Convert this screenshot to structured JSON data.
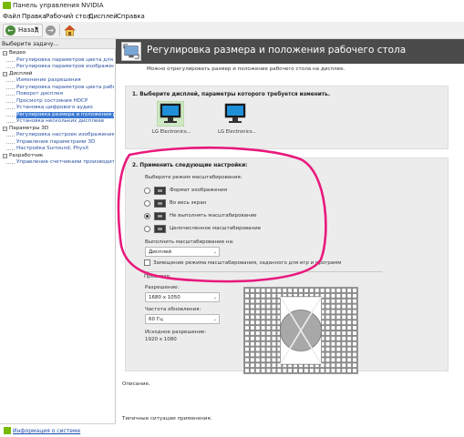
{
  "window": {
    "title": "Панель управления NVIDIA"
  },
  "menu": [
    "Файл",
    "Правка",
    "Рабочий стол",
    "Дисплей",
    "Справка"
  ],
  "toolbar": {
    "back_label": "Назад"
  },
  "left": {
    "header": "Выберите задачу...",
    "tree": [
      {
        "text": "Видео",
        "cat": true
      },
      {
        "text": "Регулировка параметров цвета для видео",
        "cat": false
      },
      {
        "text": "Регулировка параметров изображения для видео",
        "cat": false
      },
      {
        "text": "Дисплей",
        "cat": true
      },
      {
        "text": "Изменение разрешения",
        "cat": false
      },
      {
        "text": "Регулировка параметров цвета рабочего стола",
        "cat": false
      },
      {
        "text": "Поворот дисплея",
        "cat": false
      },
      {
        "text": "Просмотр состояния HDCP",
        "cat": false
      },
      {
        "text": "Установка цифрового аудио",
        "cat": false
      },
      {
        "text": "Регулировка размера и положения рабочего стола",
        "cat": false,
        "selected": true
      },
      {
        "text": "Установка нескольких дисплеев",
        "cat": false
      },
      {
        "text": "Параметры 3D",
        "cat": true
      },
      {
        "text": "Регулировка настроек изображения с просмотром",
        "cat": false
      },
      {
        "text": "Управление параметрами 3D",
        "cat": false
      },
      {
        "text": "Настройка Surround, PhysX",
        "cat": false
      },
      {
        "text": "Разработчик",
        "cat": true
      },
      {
        "text": "Управление счетчиками производительности",
        "cat": false
      }
    ],
    "system_info": "Информация о системе"
  },
  "page": {
    "title": "Регулировка размера и положения рабочего стола",
    "description": "Можно отрегулировать размер и положение рабочего стола на дисплее.",
    "section1_title": "1. Выберите дисплей, параметры которого требуется изменить.",
    "displays": [
      "LG Electronics...",
      "LG Electronics..."
    ],
    "section2_title": "2. Применить следующие настройки:",
    "scaling_mode_label": "Выберите режим масштабирования:",
    "scaling_modes": [
      "Формат изображения",
      "Во весь экран",
      "Не выполнять масштабирование",
      "Целочисленное масштабирование"
    ],
    "scaling_on_label": "Выполнить масштабирование на:",
    "scaling_on_value": "Дисплей",
    "override_label": "Замещение режима масштабирования, заданного для игр и программ",
    "preview_label": "Просмотр",
    "resolution_label": "Разрешение:",
    "resolution_value": "1680 x 1050",
    "refresh_label": "Частота обновления:",
    "refresh_value": "60 Гц",
    "native_label": "Исходное разрешение:",
    "native_value": "1920 x 1080",
    "desc_label": "Описание.",
    "usage_label": "Типичные ситуации применения."
  },
  "colors": {
    "annotation": "#e8197d",
    "nvidia_green": "#76b900",
    "header_dark": "#4b4b4b",
    "selection": "#3a78d4"
  }
}
